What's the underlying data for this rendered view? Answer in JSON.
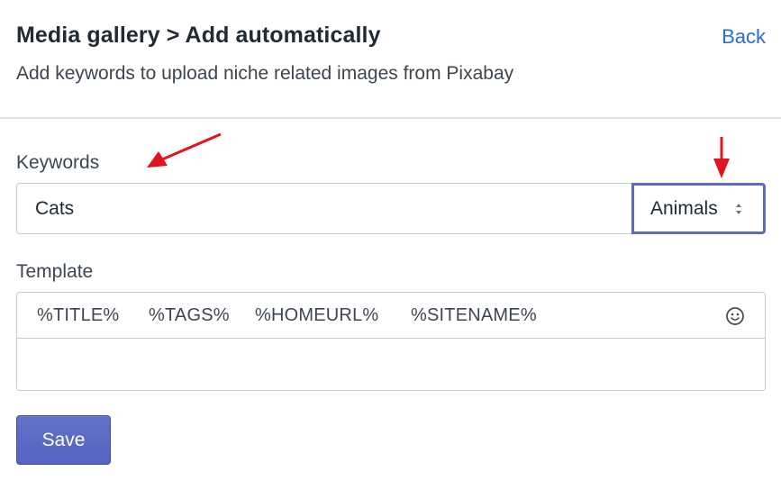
{
  "header": {
    "title": "Media gallery > Add automatically",
    "back_label": "Back",
    "subtitle": "Add keywords to upload niche related images from Pixabay"
  },
  "keywords": {
    "label": "Keywords",
    "value": "Cats",
    "category_selected": "Animals"
  },
  "template": {
    "label": "Template",
    "tokens": [
      "%TITLE%",
      "%TAGS%",
      "%HOMEURL%",
      "%SITENAME%"
    ],
    "value": ""
  },
  "actions": {
    "save_label": "Save"
  },
  "colors": {
    "accent": "#5c6ac4",
    "link": "#2c6ecb",
    "annotation": "#e0141e"
  }
}
